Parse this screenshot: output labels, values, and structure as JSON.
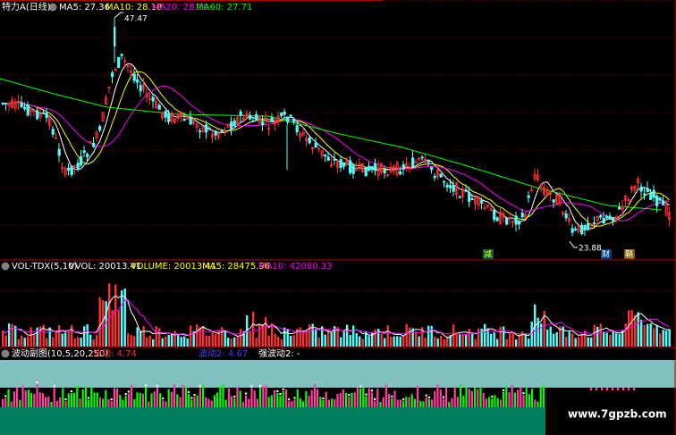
{
  "main_panel": {
    "title": "特力A(日线)",
    "ma": [
      {
        "label": "MA5: 27.36",
        "color": "#ffffff"
      },
      {
        "label": "MA10: 28.18",
        "color": "#ffff00"
      },
      {
        "label": "MA20: 28.10",
        "color": "#ff00ff"
      },
      {
        "label": "MA60: 27.71",
        "color": "#00ff00"
      }
    ],
    "high_label": "47.47",
    "low_label": "23.88",
    "markers": [
      "减",
      "财",
      "鞘"
    ]
  },
  "volume_panel": {
    "title": "VOL-TDX(5,10)",
    "items": [
      {
        "label": "VVOL: 20013.41",
        "color": "#ffffff"
      },
      {
        "label": "VOLUME: 20013.41",
        "color": "#ffff00"
      },
      {
        "label": "MA5: 28475.96",
        "color": "#ffff00"
      },
      {
        "label": "MA10: 42080.33",
        "color": "#ff00ff"
      }
    ]
  },
  "indicator_panel": {
    "title": "波动副图(10,5,20,250)",
    "items": [
      {
        "label": "波动: 4.74",
        "color": "#ff3030"
      },
      {
        "label": "波动2: 4.67",
        "color": "#4040ff"
      },
      {
        "label": "强波动2: -",
        "color": "#ffffff"
      }
    ]
  },
  "watermark": "www.7gpzb.com",
  "colors": {
    "up": "#ff3030",
    "down": "#54ffff",
    "grid": "#800000",
    "border": "#b00000",
    "ma5": "#ffffff",
    "ma10": "#ffff00",
    "ma20": "#ff00ff",
    "ma60": "#00ff00",
    "teal_band": "#80c0c0",
    "green_band": "#008060"
  }
}
